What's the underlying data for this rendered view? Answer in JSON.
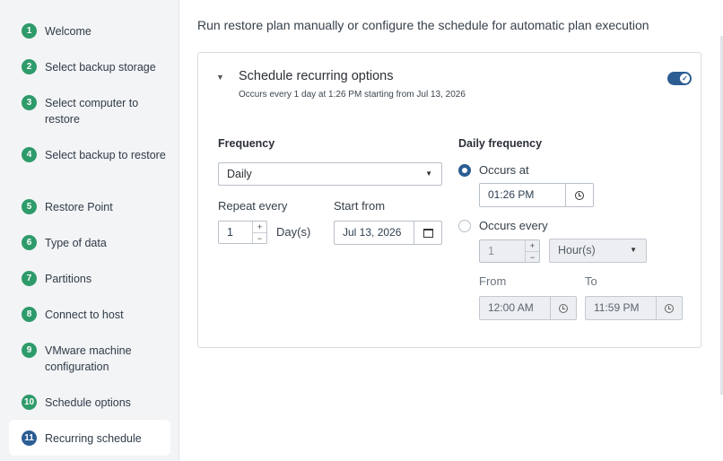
{
  "sidebar": {
    "steps": [
      {
        "num": "1",
        "label": "Welcome"
      },
      {
        "num": "2",
        "label": "Select backup storage"
      },
      {
        "num": "3",
        "label": "Select computer to restore"
      },
      {
        "num": "4",
        "label": "Select backup to restore"
      },
      {
        "num": "5",
        "label": "Restore Point"
      },
      {
        "num": "6",
        "label": "Type of data"
      },
      {
        "num": "7",
        "label": "Partitions"
      },
      {
        "num": "8",
        "label": "Connect to host"
      },
      {
        "num": "9",
        "label": "VMware machine configuration"
      },
      {
        "num": "10",
        "label": "Schedule options"
      },
      {
        "num": "11",
        "label": "Recurring schedule"
      }
    ],
    "active_step": "11"
  },
  "main": {
    "intro": "Run restore plan manually or configure the schedule for automatic plan execution",
    "card": {
      "title": "Schedule recurring options",
      "subtitle": "Occurs every 1 day at 1:26 PM starting from Jul 13, 2026",
      "toggle_on": true,
      "frequency": {
        "label": "Frequency",
        "value": "Daily",
        "repeat_label": "Repeat every",
        "repeat_value": "1",
        "repeat_unit": "Day(s)",
        "start_label": "Start from",
        "start_value": "Jul 13, 2026"
      },
      "daily": {
        "label": "Daily frequency",
        "occurs_at_label": "Occurs at",
        "occurs_at_value": "01:26 PM",
        "occurs_every_label": "Occurs every",
        "occurs_every_value": "1",
        "occurs_every_unit": "Hour(s)",
        "from_label": "From",
        "from_value": "12:00 AM",
        "to_label": "To",
        "to_value": "11:59 PM",
        "selected": "occurs_at"
      }
    }
  },
  "colors": {
    "accent": "#2b5d93",
    "step_done": "#2e9b6a"
  }
}
